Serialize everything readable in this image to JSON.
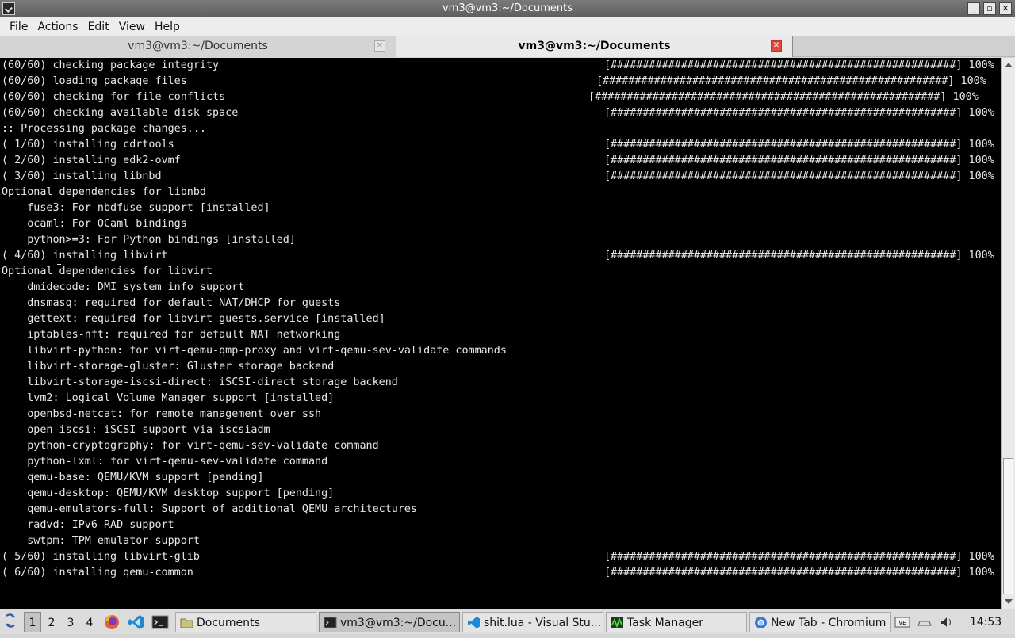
{
  "window": {
    "title": "vm3@vm3:~/Documents"
  },
  "menu": [
    "File",
    "Actions",
    "Edit",
    "View",
    "Help"
  ],
  "tabs": [
    {
      "label": "vm3@vm3:~/Documents",
      "active": false
    },
    {
      "label": "vm3@vm3:~/Documents",
      "active": true
    }
  ],
  "terminal": {
    "lines": [
      {
        "text": "(60/60) checking package integrity",
        "bar": "[######################################################] 100%",
        "bar_col": 76
      },
      {
        "text": "(60/60) loading package files",
        "bar": "[######################################################] 100%",
        "bar_col": 75
      },
      {
        "text": "(60/60) checking for file conflicts",
        "bar": "[######################################################] 100%",
        "bar_col": 74
      },
      {
        "text": "(60/60) checking available disk space",
        "bar": "[######################################################] 100%",
        "bar_col": 76
      },
      {
        "text": ":: Processing package changes...",
        "bar": "",
        "bar_col": 0
      },
      {
        "text": "( 1/60) installing cdrtools",
        "bar": "[######################################################] 100%",
        "bar_col": 76
      },
      {
        "text": "( 2/60) installing edk2-ovmf",
        "bar": "[######################################################] 100%",
        "bar_col": 76
      },
      {
        "text": "( 3/60) installing libnbd",
        "bar": "[######################################################] 100%",
        "bar_col": 76
      },
      {
        "text": "Optional dependencies for libnbd",
        "bar": "",
        "bar_col": 0
      },
      {
        "text": "    fuse3: For nbdfuse support [installed]",
        "bar": "",
        "bar_col": 0
      },
      {
        "text": "    ocaml: For OCaml bindings",
        "bar": "",
        "bar_col": 0
      },
      {
        "text": "    python>=3: For Python bindings [installed]",
        "bar": "",
        "bar_col": 0
      },
      {
        "text": "( 4/60) installing libvirt",
        "bar": "[######################################################] 100%",
        "bar_col": 76
      },
      {
        "text": "Optional dependencies for libvirt",
        "bar": "",
        "bar_col": 0
      },
      {
        "text": "    dmidecode: DMI system info support",
        "bar": "",
        "bar_col": 0
      },
      {
        "text": "    dnsmasq: required for default NAT/DHCP for guests",
        "bar": "",
        "bar_col": 0
      },
      {
        "text": "    gettext: required for libvirt-guests.service [installed]",
        "bar": "",
        "bar_col": 0
      },
      {
        "text": "    iptables-nft: required for default NAT networking",
        "bar": "",
        "bar_col": 0
      },
      {
        "text": "    libvirt-python: for virt-qemu-qmp-proxy and virt-qemu-sev-validate commands",
        "bar": "",
        "bar_col": 0
      },
      {
        "text": "    libvirt-storage-gluster: Gluster storage backend",
        "bar": "",
        "bar_col": 0
      },
      {
        "text": "    libvirt-storage-iscsi-direct: iSCSI-direct storage backend",
        "bar": "",
        "bar_col": 0
      },
      {
        "text": "    lvm2: Logical Volume Manager support [installed]",
        "bar": "",
        "bar_col": 0
      },
      {
        "text": "    openbsd-netcat: for remote management over ssh",
        "bar": "",
        "bar_col": 0
      },
      {
        "text": "    open-iscsi: iSCSI support via iscsiadm",
        "bar": "",
        "bar_col": 0
      },
      {
        "text": "    python-cryptography: for virt-qemu-sev-validate command",
        "bar": "",
        "bar_col": 0
      },
      {
        "text": "    python-lxml: for virt-qemu-sev-validate command",
        "bar": "",
        "bar_col": 0
      },
      {
        "text": "    qemu-base: QEMU/KVM support [pending]",
        "bar": "",
        "bar_col": 0
      },
      {
        "text": "    qemu-desktop: QEMU/KVM desktop support [pending]",
        "bar": "",
        "bar_col": 0
      },
      {
        "text": "    qemu-emulators-full: Support of additional QEMU architectures",
        "bar": "",
        "bar_col": 0
      },
      {
        "text": "    radvd: IPv6 RAD support",
        "bar": "",
        "bar_col": 0
      },
      {
        "text": "    swtpm: TPM emulator support",
        "bar": "",
        "bar_col": 0
      },
      {
        "text": "( 5/60) installing libvirt-glib",
        "bar": "[######################################################] 100%",
        "bar_col": 76
      },
      {
        "text": "( 6/60) installing qemu-common",
        "bar": "[######################################################] 100%",
        "bar_col": 76
      }
    ]
  },
  "taskbar": {
    "workspaces": [
      "1",
      "2",
      "3",
      "4"
    ],
    "active_workspace": "1",
    "launchers": [
      "firefox-icon",
      "vscode-icon",
      "terminal-icon"
    ],
    "tasks": [
      {
        "label": "Documents",
        "icon": "folder-icon",
        "active": false
      },
      {
        "label": "vm3@vm3:~/Docu...",
        "icon": "terminal-icon",
        "active": true
      },
      {
        "label": "shit.lua - Visual Stu...",
        "icon": "vscode-icon",
        "active": false
      },
      {
        "label": "Task Manager",
        "icon": "task-manager-icon",
        "active": false
      },
      {
        "label": "New Tab - Chromium",
        "icon": "chromium-icon",
        "active": false
      }
    ],
    "clock": "14:53"
  },
  "colors": {
    "terminal_bg": "#000000",
    "terminal_fg": "#e8e8e8",
    "close_active": "#e04a3a"
  }
}
